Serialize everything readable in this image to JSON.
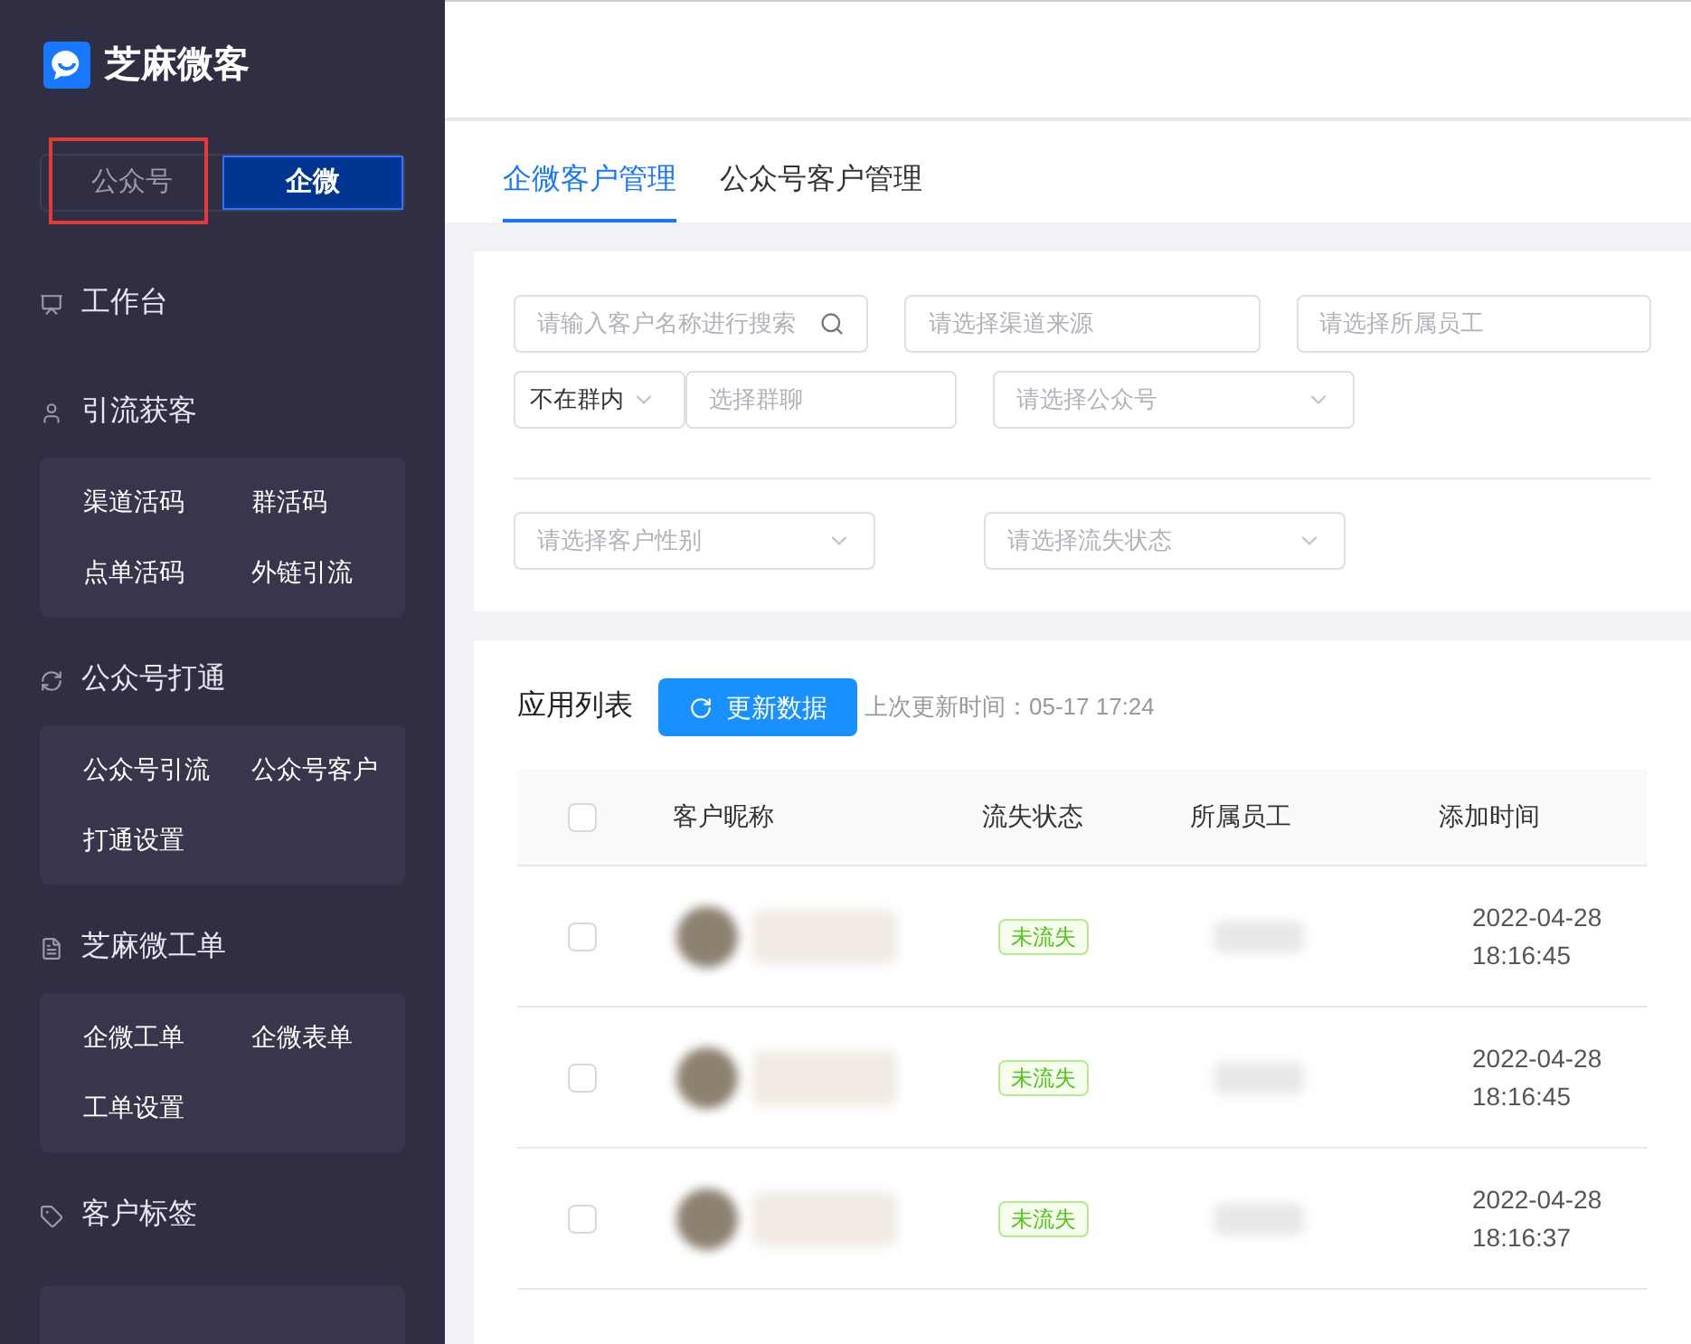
{
  "sidebar": {
    "logo": {
      "title": "芝麻微客"
    },
    "switch": [
      {
        "label": "公众号",
        "selected": false,
        "highlighted": true
      },
      {
        "label": "企微",
        "selected": true,
        "highlighted": false
      }
    ],
    "groups": [
      {
        "label": "工作台"
      },
      {
        "label": "引流获客",
        "items": [
          "渠道活码",
          "群活码",
          "点单活码",
          "外链引流"
        ]
      },
      {
        "label": "公众号打通",
        "items": [
          "公众号引流",
          "公众号客户",
          "打通设置"
        ]
      },
      {
        "label": "芝麻微工单",
        "items": [
          "企微工单",
          "企微表单",
          "工单设置"
        ]
      },
      {
        "label": "客户标签"
      }
    ]
  },
  "tabs": [
    {
      "label": "企微客户管理",
      "selected": true
    },
    {
      "label": "公众号客户管理",
      "selected": false
    }
  ],
  "filters": {
    "row1": [
      {
        "kind": "search",
        "placeholder": "请输入客户名称进行搜索"
      },
      {
        "kind": "input",
        "placeholder": "请选择渠道来源"
      },
      {
        "kind": "input",
        "placeholder": "请选择所属员工"
      }
    ],
    "group_mode": "不在群内",
    "group_chat": {
      "placeholder": "选择群聊"
    },
    "official_account": {
      "placeholder": "请选择公众号"
    },
    "row3": [
      {
        "kind": "select",
        "placeholder": "请选择客户性别"
      },
      {
        "kind": "select",
        "placeholder": "请选择流失状态"
      }
    ]
  },
  "list": {
    "title": "应用列表",
    "refresh_button": "更新数据",
    "last_update": "上次更新时间：05-17 17:24",
    "select_all": false,
    "columns": [
      "客户昵称",
      "流失状态",
      "所属员工",
      "添加时间"
    ],
    "rows": [
      {
        "checked": false,
        "status": "未流失",
        "date": "2022-04-28",
        "time": "18:16:45"
      },
      {
        "checked": false,
        "status": "未流失",
        "date": "2022-04-28",
        "time": "18:16:45"
      },
      {
        "checked": false,
        "status": "未流失",
        "date": "2022-04-28",
        "time": "18:16:37"
      }
    ]
  }
}
